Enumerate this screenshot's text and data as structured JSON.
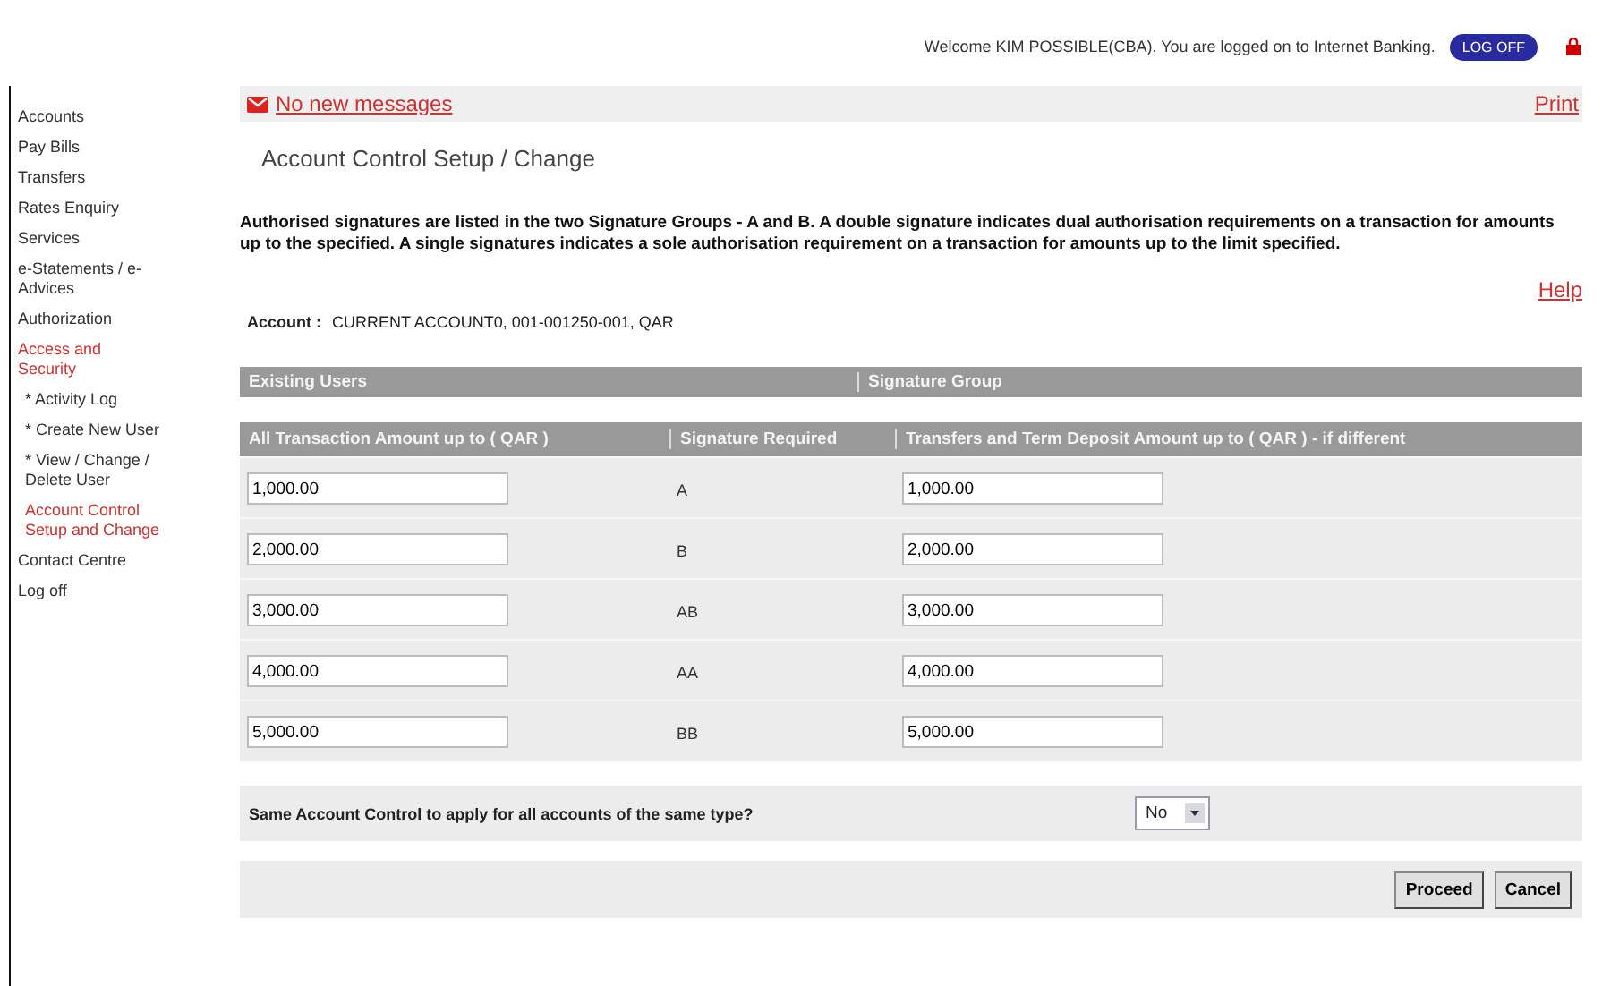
{
  "header": {
    "welcome": "Welcome KIM POSSIBLE(CBA). You are logged on to Internet Banking.",
    "logoff": "LOG OFF"
  },
  "sidebar": {
    "items": [
      {
        "label": "Accounts",
        "selected": false
      },
      {
        "label": "Pay Bills",
        "selected": false
      },
      {
        "label": "Transfers",
        "selected": false
      },
      {
        "label": "Rates Enquiry",
        "selected": false
      },
      {
        "label": "Services",
        "selected": false
      },
      {
        "label": "e-Statements / e-Advices",
        "selected": false
      },
      {
        "label": "Authorization",
        "selected": false
      },
      {
        "label": "Access and Security",
        "selected": true,
        "children": [
          {
            "label": "* Activity Log",
            "selected": false
          },
          {
            "label": "* Create New User",
            "selected": false
          },
          {
            "label": "* View / Change / Delete User",
            "selected": false
          },
          {
            "label": "Account Control Setup and Change",
            "selected": true
          }
        ]
      },
      {
        "label": "Contact Centre",
        "selected": false
      },
      {
        "label": "Log off",
        "selected": false
      }
    ]
  },
  "messages": {
    "link": "No new messages",
    "print": "Print"
  },
  "title": "Account Control Setup / Change",
  "intro": "Authorised signatures are listed in the two Signature Groups - A and B. A double signature indicates dual authorisation requirements on a transaction for amounts up to the specified. A single signatures indicates a sole authorisation requirement on a transaction for amounts up to the limit specified.",
  "help": "Help",
  "account": {
    "label": "Account :",
    "value": "CURRENT ACCOUNT0, 001-001250-001, QAR"
  },
  "group_header": [
    "Existing Users",
    "Signature Group"
  ],
  "table": {
    "columns": [
      "All Transaction Amount up to ( QAR )",
      "Signature Required",
      "Transfers and Term Deposit Amount up to ( QAR ) - if different"
    ],
    "rows": [
      {
        "amount": "1,000.00",
        "signature": "A",
        "transfer": "1,000.00"
      },
      {
        "amount": "2,000.00",
        "signature": "B",
        "transfer": "2,000.00"
      },
      {
        "amount": "3,000.00",
        "signature": "AB",
        "transfer": "3,000.00"
      },
      {
        "amount": "4,000.00",
        "signature": "AA",
        "transfer": "4,000.00"
      },
      {
        "amount": "5,000.00",
        "signature": "BB",
        "transfer": "5,000.00"
      }
    ]
  },
  "question": {
    "label": "Same Account Control to apply for all accounts of the same type?",
    "value": "No"
  },
  "buttons": [
    "Proceed",
    "Cancel"
  ]
}
